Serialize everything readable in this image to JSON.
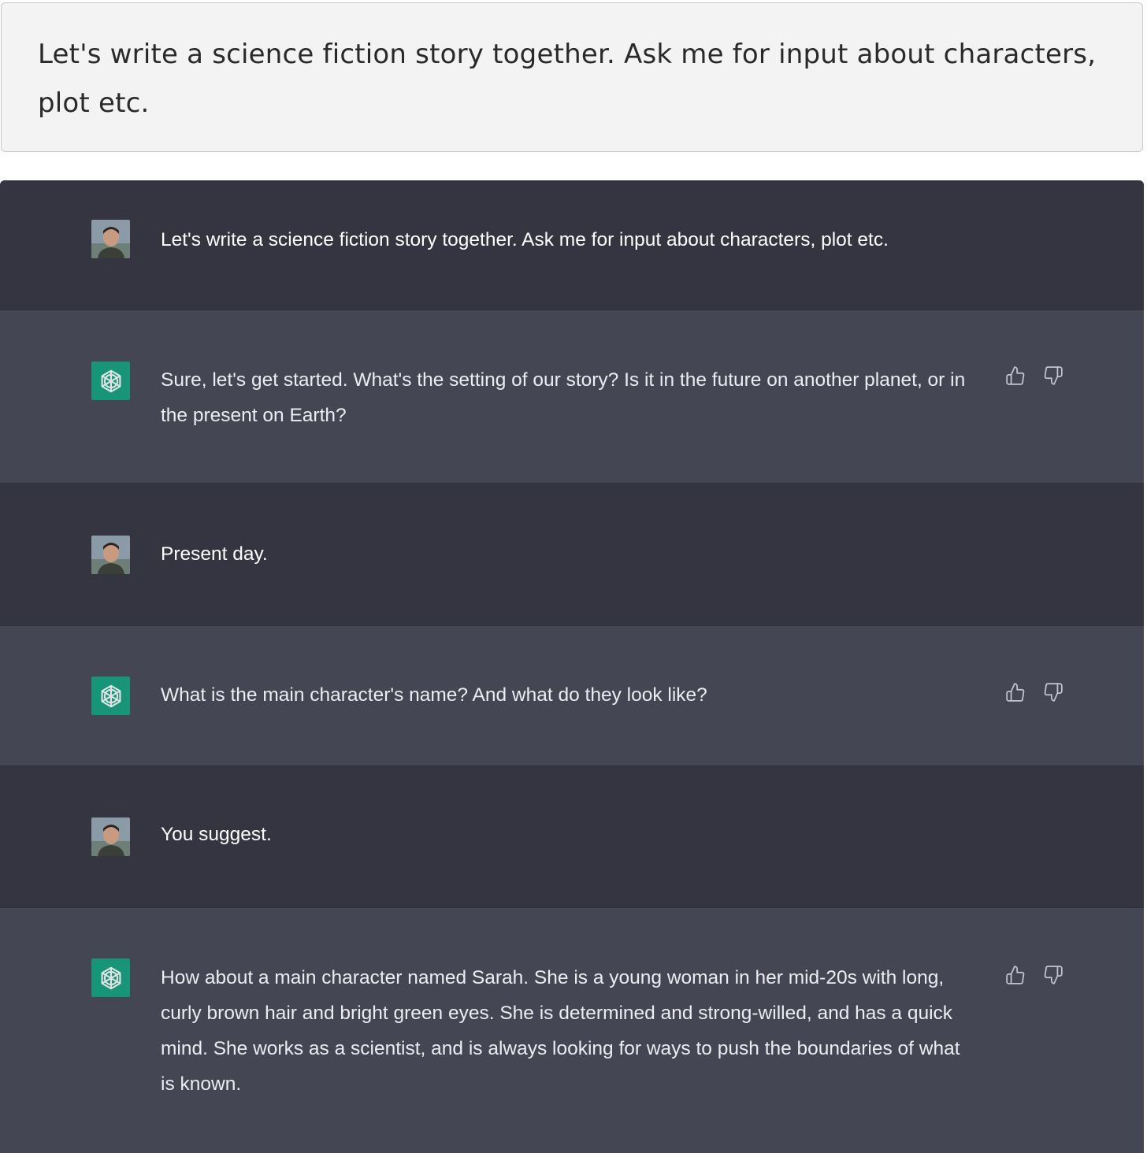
{
  "prompt": {
    "text": "Let's write a science fiction story together. Ask me for input about characters, plot etc."
  },
  "conversation": [
    {
      "role": "user",
      "avatar_icon": "user-photo-avatar",
      "text": "Let's write a science fiction story together. Ask me for input about characters, plot etc."
    },
    {
      "role": "assistant",
      "avatar_icon": "openai-logo-icon",
      "text": "Sure, let's get started. What's the setting of our story? Is it in the future on another planet, or in the present on Earth?",
      "feedback_icons": [
        "thumbs-up-icon",
        "thumbs-down-icon"
      ]
    },
    {
      "role": "user",
      "avatar_icon": "user-photo-avatar",
      "text": "Present day."
    },
    {
      "role": "assistant",
      "avatar_icon": "openai-logo-icon",
      "text": "What is the main character's name? And what do they look like?",
      "feedback_icons": [
        "thumbs-up-icon",
        "thumbs-down-icon"
      ]
    },
    {
      "role": "user",
      "avatar_icon": "user-photo-avatar",
      "text": "You suggest."
    },
    {
      "role": "assistant",
      "avatar_icon": "openai-logo-icon",
      "text": "How about a main character named Sarah. She is a young woman in her mid-20s with long, curly brown hair and bright green eyes. She is determined and strong-willed, and has a quick mind. She works as a scientist, and is always looking for ways to push the boundaries of what is known.",
      "feedback_icons": [
        "thumbs-up-icon",
        "thumbs-down-icon"
      ]
    }
  ],
  "colors": {
    "user_bg": "#343541",
    "assistant_bg": "#444654",
    "assistant_avatar": "#10a37f",
    "prompt_bg": "#f3f3f3"
  }
}
